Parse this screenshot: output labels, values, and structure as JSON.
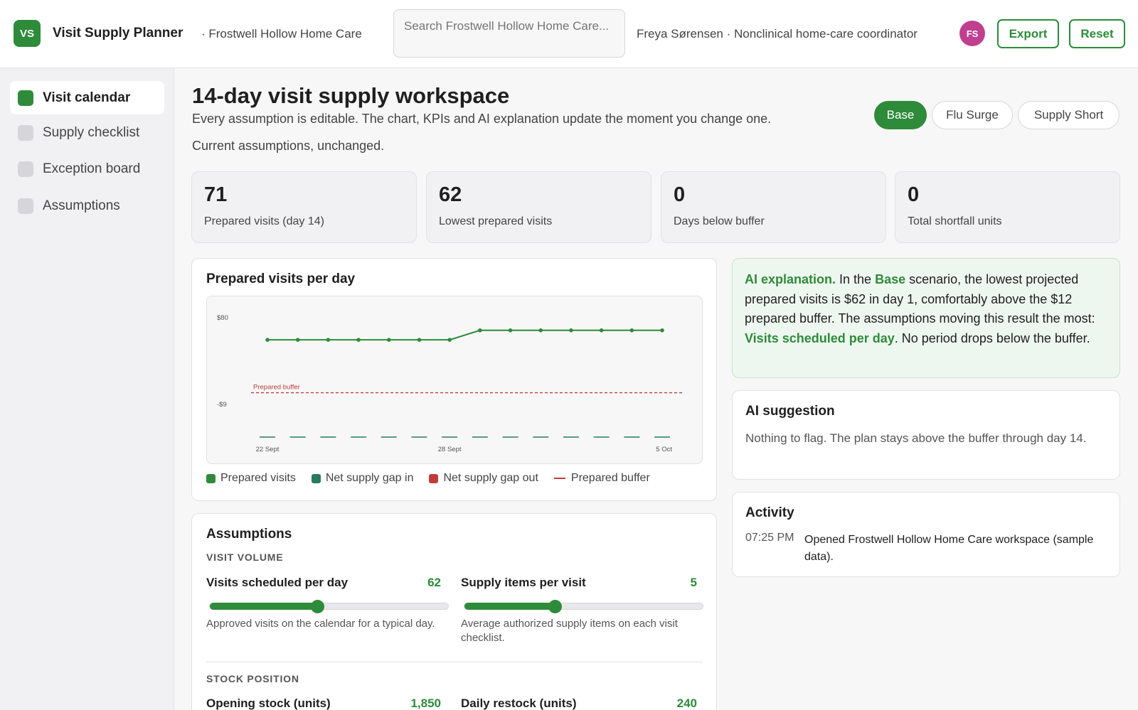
{
  "header": {
    "logo": "VS",
    "app_title": "Visit Supply Planner",
    "org": "· Frostwell Hollow Home Care",
    "search_placeholder": "Search Frostwell Hollow Home Care...",
    "user": "Freya Sørensen · Nonclinical home-care coordinator",
    "avatar_initials": "FS",
    "export_label": "Export",
    "reset_label": "Reset"
  },
  "sidebar": {
    "items": [
      {
        "label": "Visit calendar",
        "active": true
      },
      {
        "label": "Supply checklist",
        "active": false
      },
      {
        "label": "Exception board",
        "active": false
      },
      {
        "label": "Assumptions",
        "active": false
      }
    ]
  },
  "main": {
    "title": "14-day visit supply workspace",
    "subtitle": "Every assumption is editable. The chart, KPIs and AI explanation update the moment you change one.",
    "status": "Current assumptions, unchanged.",
    "scenarios": [
      {
        "label": "Base",
        "active": true
      },
      {
        "label": "Flu Surge",
        "active": false
      },
      {
        "label": "Supply Short",
        "active": false
      }
    ]
  },
  "kpis": [
    {
      "value": "71",
      "label": "Prepared visits (day 14)"
    },
    {
      "value": "62",
      "label": "Lowest prepared visits"
    },
    {
      "value": "0",
      "label": "Days below buffer"
    },
    {
      "value": "0",
      "label": "Total shortfall units"
    }
  ],
  "chart_card": {
    "title": "Prepared visits per day",
    "legend": [
      {
        "label": "Prepared visits",
        "color": "#2e8b3a",
        "kind": "square"
      },
      {
        "label": "Net supply gap in",
        "color": "#2a7a5a",
        "kind": "square"
      },
      {
        "label": "Net supply gap out",
        "color": "#c23b3b",
        "kind": "square"
      },
      {
        "label": "Prepared buffer",
        "color": "#c23b3b",
        "kind": "line"
      }
    ]
  },
  "chart_data": {
    "type": "line",
    "x": [
      "22 Sept",
      "23 Sept",
      "24 Sept",
      "25 Sept",
      "26 Sept",
      "27 Sept",
      "28 Sept",
      "29 Sept",
      "30 Sept",
      "1 Oct",
      "2 Oct",
      "3 Oct",
      "4 Oct",
      "5 Oct"
    ],
    "x_tick_labels": [
      "22 Sept",
      "28 Sept",
      "5 Oct"
    ],
    "y_tick_labels": [
      "$80",
      "-$9"
    ],
    "ylim": [
      -30,
      87
    ],
    "series": [
      {
        "name": "Prepared visits",
        "values": [
          62,
          62,
          62,
          62,
          62,
          62,
          62,
          71,
          71,
          71,
          71,
          71,
          71,
          71
        ],
        "color": "#2e8b3a"
      },
      {
        "name": "Net supply gap in",
        "values": [
          -30,
          -30,
          -30,
          -30,
          -30,
          -30,
          -30,
          -30,
          -30,
          -30,
          -30,
          -30,
          -30,
          -30
        ],
        "color": "#2a7a5a"
      }
    ],
    "buffer": {
      "label": "Prepared buffer",
      "value": 12,
      "color": "#c23b3b"
    },
    "grid": false
  },
  "ai_explanation": {
    "label": "AI explanation.",
    "t1": " In the ",
    "scenario": "Base",
    "t2": " scenario, the lowest projected prepared visits is $62 in day 1, comfortably above the $12 prepared buffer. The assumptions moving this result the most: ",
    "driver": "Visits scheduled per day",
    "t3": ". No period drops below the buffer."
  },
  "ai_suggestion": {
    "title": "AI suggestion",
    "text": "Nothing to flag. The plan stays above the buffer through day 14."
  },
  "activity": {
    "title": "Activity",
    "items": [
      {
        "time": "07:25 PM",
        "text": "Opened Frostwell Hollow Home Care workspace (sample data)."
      }
    ]
  },
  "assumptions": {
    "title": "Assumptions",
    "sections": [
      {
        "heading": "VISIT VOLUME",
        "sliders": [
          {
            "label": "Visits scheduled per day",
            "value": "62",
            "level": 0.45,
            "help": "Approved visits on the calendar for a typical day."
          },
          {
            "label": "Supply items per visit",
            "value": "5",
            "level": 0.38,
            "help": "Average authorized supply items on each visit checklist."
          }
        ]
      },
      {
        "heading": "STOCK POSITION",
        "sliders": [
          {
            "label": "Opening stock (units)",
            "value": "1,850"
          },
          {
            "label": "Daily restock (units)",
            "value": "240"
          }
        ]
      }
    ]
  }
}
